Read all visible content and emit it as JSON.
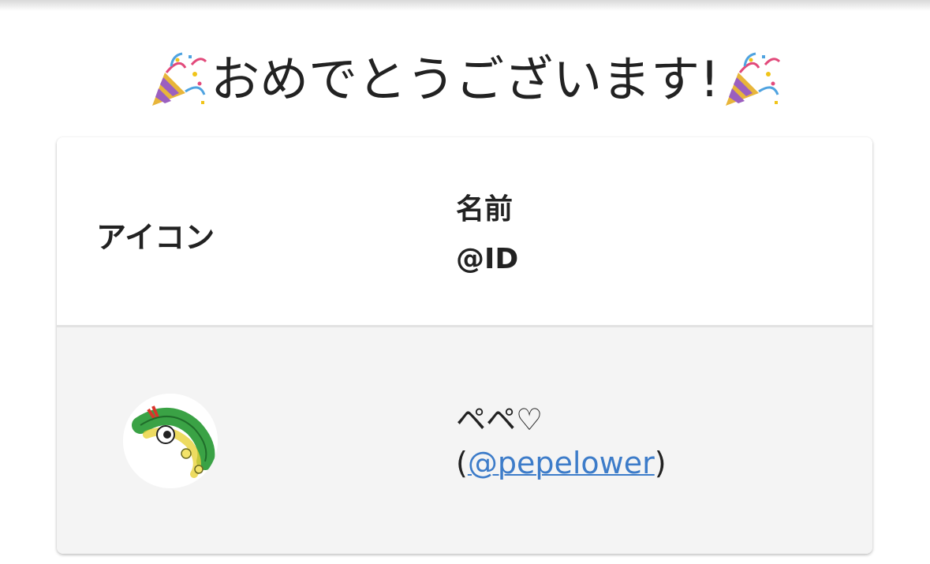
{
  "header": {
    "title": "おめでとうございます!",
    "decoration_icon": "party-popper-icon"
  },
  "table": {
    "columns": {
      "icon_header": "アイコン",
      "name_header": "名前",
      "id_header": "@ID"
    },
    "rows": [
      {
        "avatar_icon": "caterpie-avatar",
        "name": "ペペ♡",
        "id_open": "(",
        "id_link": "@pepelower",
        "id_close": ")"
      }
    ]
  },
  "colors": {
    "link": "#3d7cc9",
    "row_background": "#f4f4f4",
    "divider": "#e2e2e2"
  }
}
